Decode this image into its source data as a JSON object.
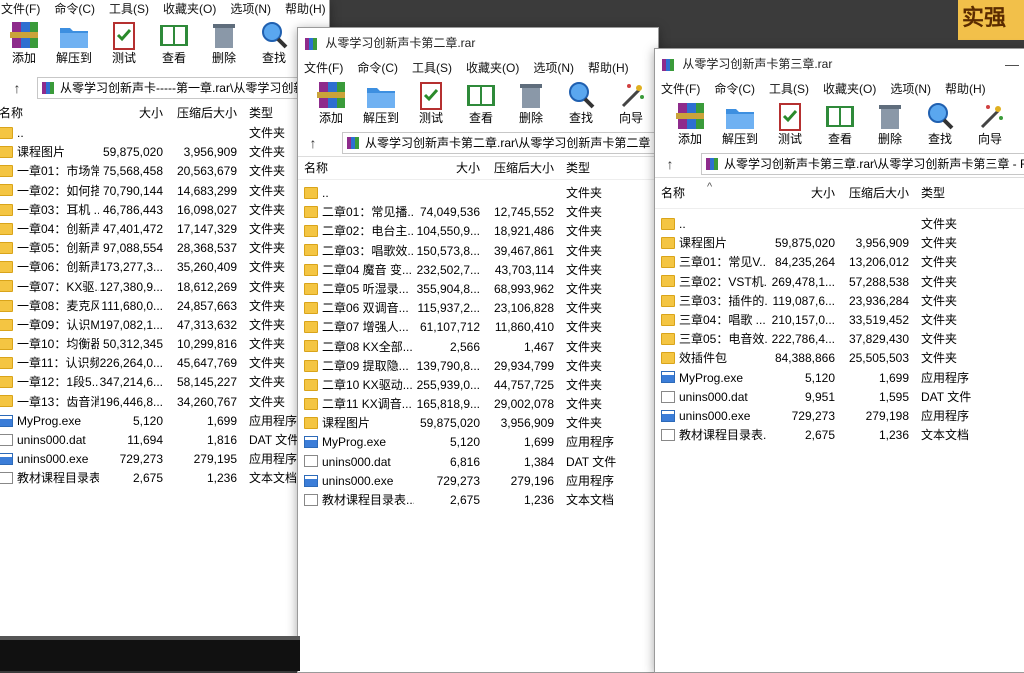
{
  "background": {
    "banner_text": "实强"
  },
  "w1": {
    "menu": [
      "文件(F)",
      "命令(C)",
      "工具(S)",
      "收藏夹(O)",
      "选项(N)",
      "帮助(H)"
    ],
    "toolbar": [
      "添加",
      "解压到",
      "测试",
      "查看",
      "删除",
      "查找"
    ],
    "path": "从零学习创新声卡-----第一章.rar\\从零学习创新声卡",
    "headers": {
      "name": "名称",
      "size": "大小",
      "packed": "压缩后大小",
      "type": "类型"
    },
    "rows": [
      {
        "icon": "folder",
        "name": "..",
        "size": "",
        "packed": "",
        "type": "文件夹"
      },
      {
        "icon": "folder",
        "name": "课程图片",
        "size": "59,875,020",
        "packed": "3,956,909",
        "type": "文件夹"
      },
      {
        "icon": "folder",
        "name": "一章01：市场常...",
        "size": "75,568,458",
        "packed": "20,563,679",
        "type": "文件夹"
      },
      {
        "icon": "folder",
        "name": "一章02：如何搭...",
        "size": "70,790,144",
        "packed": "14,683,299",
        "type": "文件夹"
      },
      {
        "icon": "folder",
        "name": "一章03：耳机 ...",
        "size": "46,786,443",
        "packed": "16,098,027",
        "type": "文件夹"
      },
      {
        "icon": "folder",
        "name": "一章04：创新声...",
        "size": "47,401,472",
        "packed": "17,147,329",
        "type": "文件夹"
      },
      {
        "icon": "folder",
        "name": "一章05：创新声...",
        "size": "97,088,554",
        "packed": "28,368,537",
        "type": "文件夹"
      },
      {
        "icon": "folder",
        "name": "一章06：创新声...",
        "size": "173,277,3...",
        "packed": "35,260,409",
        "type": "文件夹"
      },
      {
        "icon": "folder",
        "name": "一章07：KX驱...",
        "size": "127,380,9...",
        "packed": "18,612,269",
        "type": "文件夹"
      },
      {
        "icon": "folder",
        "name": "一章08：麦克风...",
        "size": "111,680,0...",
        "packed": "24,857,663",
        "type": "文件夹"
      },
      {
        "icon": "folder",
        "name": "一章09：认识M...",
        "size": "197,082,1...",
        "packed": "47,313,632",
        "type": "文件夹"
      },
      {
        "icon": "folder",
        "name": "一章10：均衡器...",
        "size": "50,312,345",
        "packed": "10,299,816",
        "type": "文件夹"
      },
      {
        "icon": "folder",
        "name": "一章11：认识频...",
        "size": "226,264,0...",
        "packed": "45,647,769",
        "type": "文件夹"
      },
      {
        "icon": "folder",
        "name": "一章12：1段5...",
        "size": "347,214,6...",
        "packed": "58,145,227",
        "type": "文件夹"
      },
      {
        "icon": "folder",
        "name": "一章13：齿音消...",
        "size": "196,446,8...",
        "packed": "34,260,767",
        "type": "文件夹"
      },
      {
        "icon": "exe",
        "name": "MyProg.exe",
        "size": "5,120",
        "packed": "1,699",
        "type": "应用程序"
      },
      {
        "icon": "doc",
        "name": "unins000.dat",
        "size": "11,694",
        "packed": "1,816",
        "type": "DAT 文件"
      },
      {
        "icon": "exe",
        "name": "unins000.exe",
        "size": "729,273",
        "packed": "279,195",
        "type": "应用程序"
      },
      {
        "icon": "doc",
        "name": "教材课程目录表...",
        "size": "2,675",
        "packed": "1,236",
        "type": "文本文档"
      }
    ]
  },
  "w2": {
    "title": "从零学习创新声卡第二章.rar",
    "menu": [
      "文件(F)",
      "命令(C)",
      "工具(S)",
      "收藏夹(O)",
      "选项(N)",
      "帮助(H)"
    ],
    "toolbar": [
      "添加",
      "解压到",
      "测试",
      "查看",
      "删除",
      "查找",
      "向导"
    ],
    "path": "从零学习创新声卡第二章.rar\\从零学习创新声卡第二章 - RA",
    "headers": {
      "name": "名称",
      "size": "大小",
      "packed": "压缩后大小",
      "type": "类型"
    },
    "rows": [
      {
        "icon": "folder",
        "name": "..",
        "size": "",
        "packed": "",
        "type": "文件夹"
      },
      {
        "icon": "folder",
        "name": "二章01：常见播...",
        "size": "74,049,536",
        "packed": "12,745,552",
        "type": "文件夹"
      },
      {
        "icon": "folder",
        "name": "二章02：电台主...",
        "size": "104,550,9...",
        "packed": "18,921,486",
        "type": "文件夹"
      },
      {
        "icon": "folder",
        "name": "二章03：唱歌效...",
        "size": "150,573,8...",
        "packed": "39,467,861",
        "type": "文件夹"
      },
      {
        "icon": "folder",
        "name": "二章04 魔音 变...",
        "size": "232,502,7...",
        "packed": "43,703,114",
        "type": "文件夹"
      },
      {
        "icon": "folder",
        "name": "二章05 听湿录...",
        "size": "355,904,8...",
        "packed": "68,993,962",
        "type": "文件夹"
      },
      {
        "icon": "folder",
        "name": "二章06 双调音...",
        "size": "115,937,2...",
        "packed": "23,106,828",
        "type": "文件夹"
      },
      {
        "icon": "folder",
        "name": "二章07 增强人...",
        "size": "61,107,712",
        "packed": "11,860,410",
        "type": "文件夹"
      },
      {
        "icon": "folder",
        "name": "二章08 KX全部...",
        "size": "2,566",
        "packed": "1,467",
        "type": "文件夹"
      },
      {
        "icon": "folder",
        "name": "二章09 提取隐...",
        "size": "139,790,8...",
        "packed": "29,934,799",
        "type": "文件夹"
      },
      {
        "icon": "folder",
        "name": "二章10 KX驱动...",
        "size": "255,939,0...",
        "packed": "44,757,725",
        "type": "文件夹"
      },
      {
        "icon": "folder",
        "name": "二章11 KX调音...",
        "size": "165,818,9...",
        "packed": "29,002,078",
        "type": "文件夹"
      },
      {
        "icon": "folder",
        "name": "课程图片",
        "size": "59,875,020",
        "packed": "3,956,909",
        "type": "文件夹"
      },
      {
        "icon": "exe",
        "name": "MyProg.exe",
        "size": "5,120",
        "packed": "1,699",
        "type": "应用程序"
      },
      {
        "icon": "doc",
        "name": "unins000.dat",
        "size": "6,816",
        "packed": "1,384",
        "type": "DAT 文件"
      },
      {
        "icon": "exe",
        "name": "unins000.exe",
        "size": "729,273",
        "packed": "279,196",
        "type": "应用程序"
      },
      {
        "icon": "doc",
        "name": "教材课程目录表...",
        "size": "2,675",
        "packed": "1,236",
        "type": "文本文档"
      }
    ]
  },
  "w3": {
    "title": "从零学习创新声卡第三章.rar",
    "menu": [
      "文件(F)",
      "命令(C)",
      "工具(S)",
      "收藏夹(O)",
      "选项(N)",
      "帮助(H)"
    ],
    "toolbar": [
      "添加",
      "解压到",
      "测试",
      "查看",
      "删除",
      "查找",
      "向导"
    ],
    "path": "从零学习创新声卡第三章.rar\\从零学习创新声卡第三章 - RAR",
    "headers": {
      "name": "名称",
      "size": "大小",
      "packed": "压缩后大小",
      "type": "类型"
    },
    "rows": [
      {
        "icon": "folder",
        "name": "..",
        "size": "",
        "packed": "",
        "type": "文件夹"
      },
      {
        "icon": "folder",
        "name": "课程图片",
        "size": "59,875,020",
        "packed": "3,956,909",
        "type": "文件夹"
      },
      {
        "icon": "folder",
        "name": "三章01：常见V...",
        "size": "84,235,264",
        "packed": "13,206,012",
        "type": "文件夹"
      },
      {
        "icon": "folder",
        "name": "三章02：VST机...",
        "size": "269,478,1...",
        "packed": "57,288,538",
        "type": "文件夹"
      },
      {
        "icon": "folder",
        "name": "三章03：插件的...",
        "size": "119,087,6...",
        "packed": "23,936,284",
        "type": "文件夹"
      },
      {
        "icon": "folder",
        "name": "三章04：唱歌 ...",
        "size": "210,157,0...",
        "packed": "33,519,452",
        "type": "文件夹"
      },
      {
        "icon": "folder",
        "name": "三章05：电音效...",
        "size": "222,786,4...",
        "packed": "37,829,430",
        "type": "文件夹"
      },
      {
        "icon": "folder",
        "name": "效插件包",
        "size": "84,388,866",
        "packed": "25,505,503",
        "type": "文件夹"
      },
      {
        "icon": "exe",
        "name": "MyProg.exe",
        "size": "5,120",
        "packed": "1,699",
        "type": "应用程序"
      },
      {
        "icon": "doc",
        "name": "unins000.dat",
        "size": "9,951",
        "packed": "1,595",
        "type": "DAT 文件"
      },
      {
        "icon": "exe",
        "name": "unins000.exe",
        "size": "729,273",
        "packed": "279,198",
        "type": "应用程序"
      },
      {
        "icon": "doc",
        "name": "教材课程目录表...",
        "size": "2,675",
        "packed": "1,236",
        "type": "文本文档"
      }
    ]
  }
}
